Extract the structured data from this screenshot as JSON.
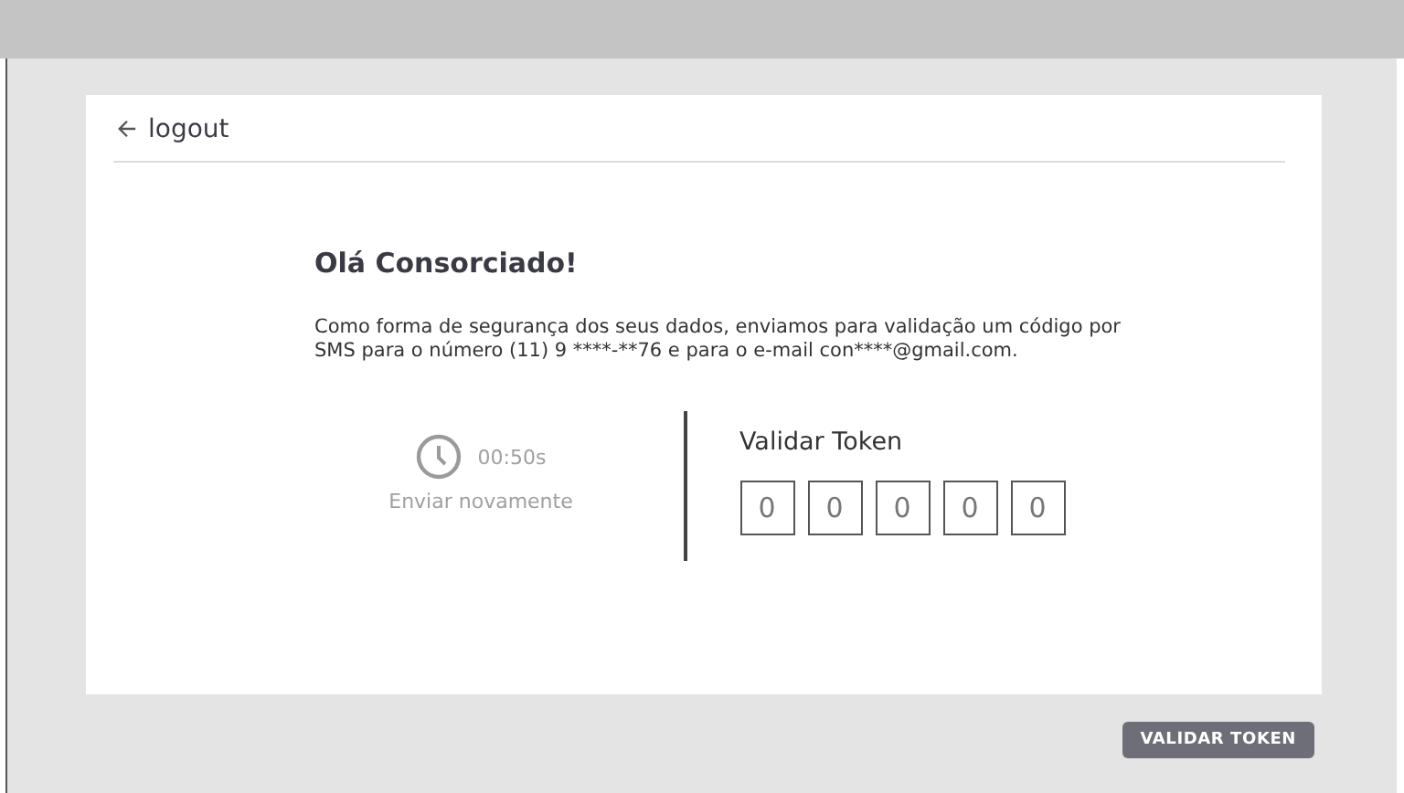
{
  "header": {
    "back_label": "logout"
  },
  "greeting": "Olá Consorciado!",
  "message": "Como forma de segurança dos seus dados, enviamos para validação um código por SMS para o número (11) 9 ****-**76 e para o e-mail con****@gmail.com.",
  "resend": {
    "timer": "00:50s",
    "label": "Enviar novamente",
    "disabled": true
  },
  "token": {
    "title": "Validar Token",
    "digits": [
      "0",
      "0",
      "0",
      "0",
      "0"
    ]
  },
  "submit_button": "VALIDAR TOKEN"
}
